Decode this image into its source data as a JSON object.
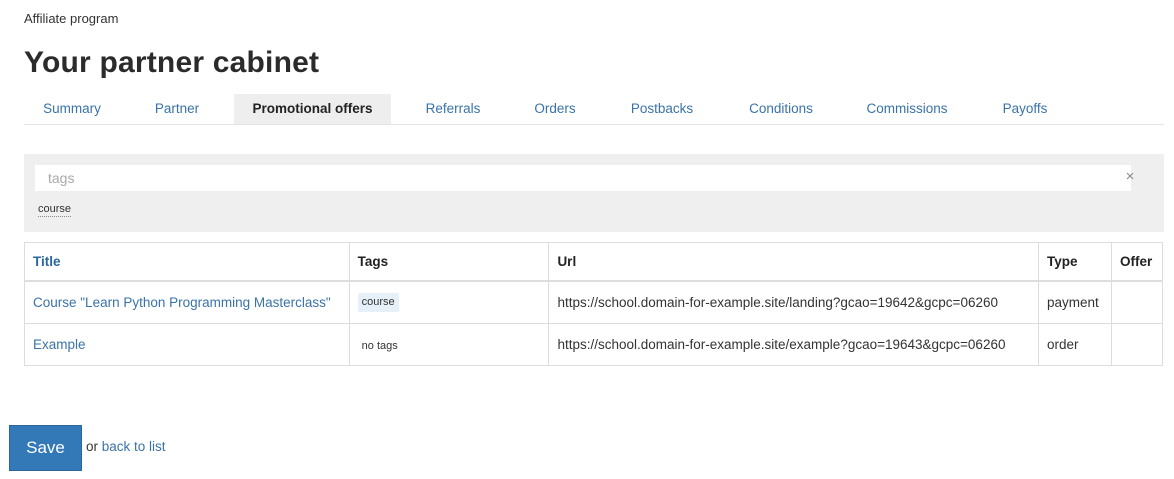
{
  "breadcrumb": "Affiliate program",
  "page_title": "Your partner cabinet",
  "tabs": [
    {
      "label": "Summary"
    },
    {
      "label": "Partner"
    },
    {
      "label": "Promotional offers"
    },
    {
      "label": "Referrals"
    },
    {
      "label": "Orders"
    },
    {
      "label": "Postbacks"
    },
    {
      "label": "Conditions"
    },
    {
      "label": "Commissions"
    },
    {
      "label": "Payoffs"
    }
  ],
  "active_tab": "Promotional offers",
  "filter": {
    "placeholder": "tags",
    "value": "",
    "clear_symbol": "×",
    "available_tags": [
      "course"
    ]
  },
  "table": {
    "headers": {
      "title": "Title",
      "tags": "Tags",
      "url": "Url",
      "type": "Type",
      "offer": "Offer"
    },
    "rows": [
      {
        "title": "Course \"Learn Python Programming Masterclass\"",
        "tag": "course",
        "url": "https://school.domain-for-example.site/landing?gcao=19642&gcpc=06260",
        "type": "payment",
        "offer": ""
      },
      {
        "title": "Example",
        "tag": "no tags",
        "url": "https://school.domain-for-example.site/example?gcao=19643&gcpc=06260",
        "type": "order",
        "offer": ""
      }
    ]
  },
  "footer": {
    "save_label": "Save",
    "or_text": "or",
    "back_label": "back to list"
  },
  "colors": {
    "link": "#3a73a8",
    "primary_button": "#3479b7",
    "panel_bg": "#efefef",
    "tag_bg": "#e6f0f8"
  }
}
